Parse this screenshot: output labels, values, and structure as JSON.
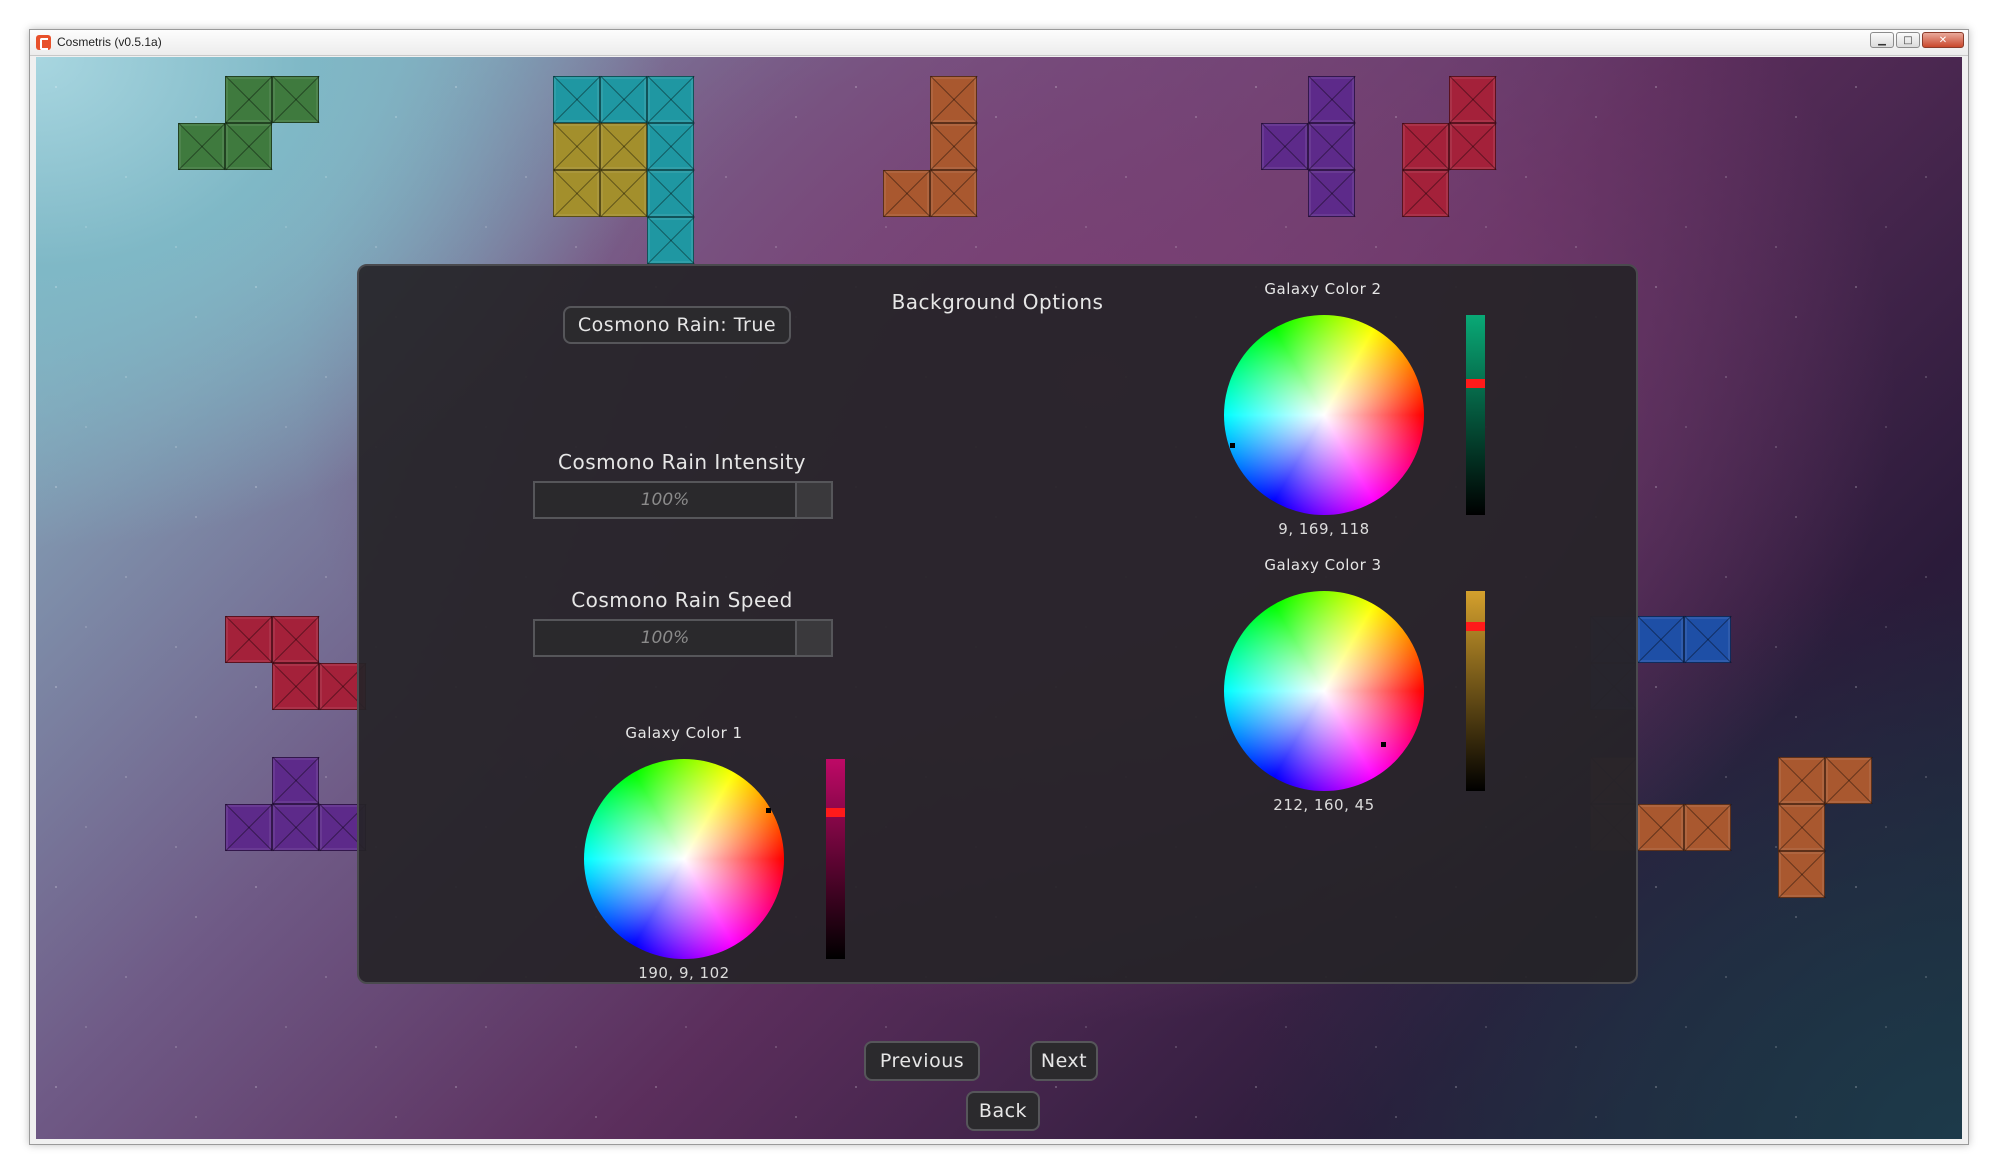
{
  "window": {
    "title": "Cosmetris (v0.5.1a)"
  },
  "panel": {
    "title": "Background Options",
    "rain_toggle_label": "Cosmono Rain: True",
    "intensity": {
      "label": "Cosmono Rain Intensity",
      "value": "100%"
    },
    "speed": {
      "label": "Cosmono Rain Speed",
      "value": "100%"
    },
    "galaxy1": {
      "label": "Galaxy Color 1",
      "rgb": "190, 9, 102",
      "color": "#be0966"
    },
    "galaxy2": {
      "label": "Galaxy Color 2",
      "rgb": "9, 169, 118",
      "color": "#09a976"
    },
    "galaxy3": {
      "label": "Galaxy Color 3",
      "rgb": "212, 160, 45",
      "color": "#d4a02d"
    }
  },
  "nav": {
    "previous": "Previous",
    "next": "Next",
    "back": "Back"
  }
}
